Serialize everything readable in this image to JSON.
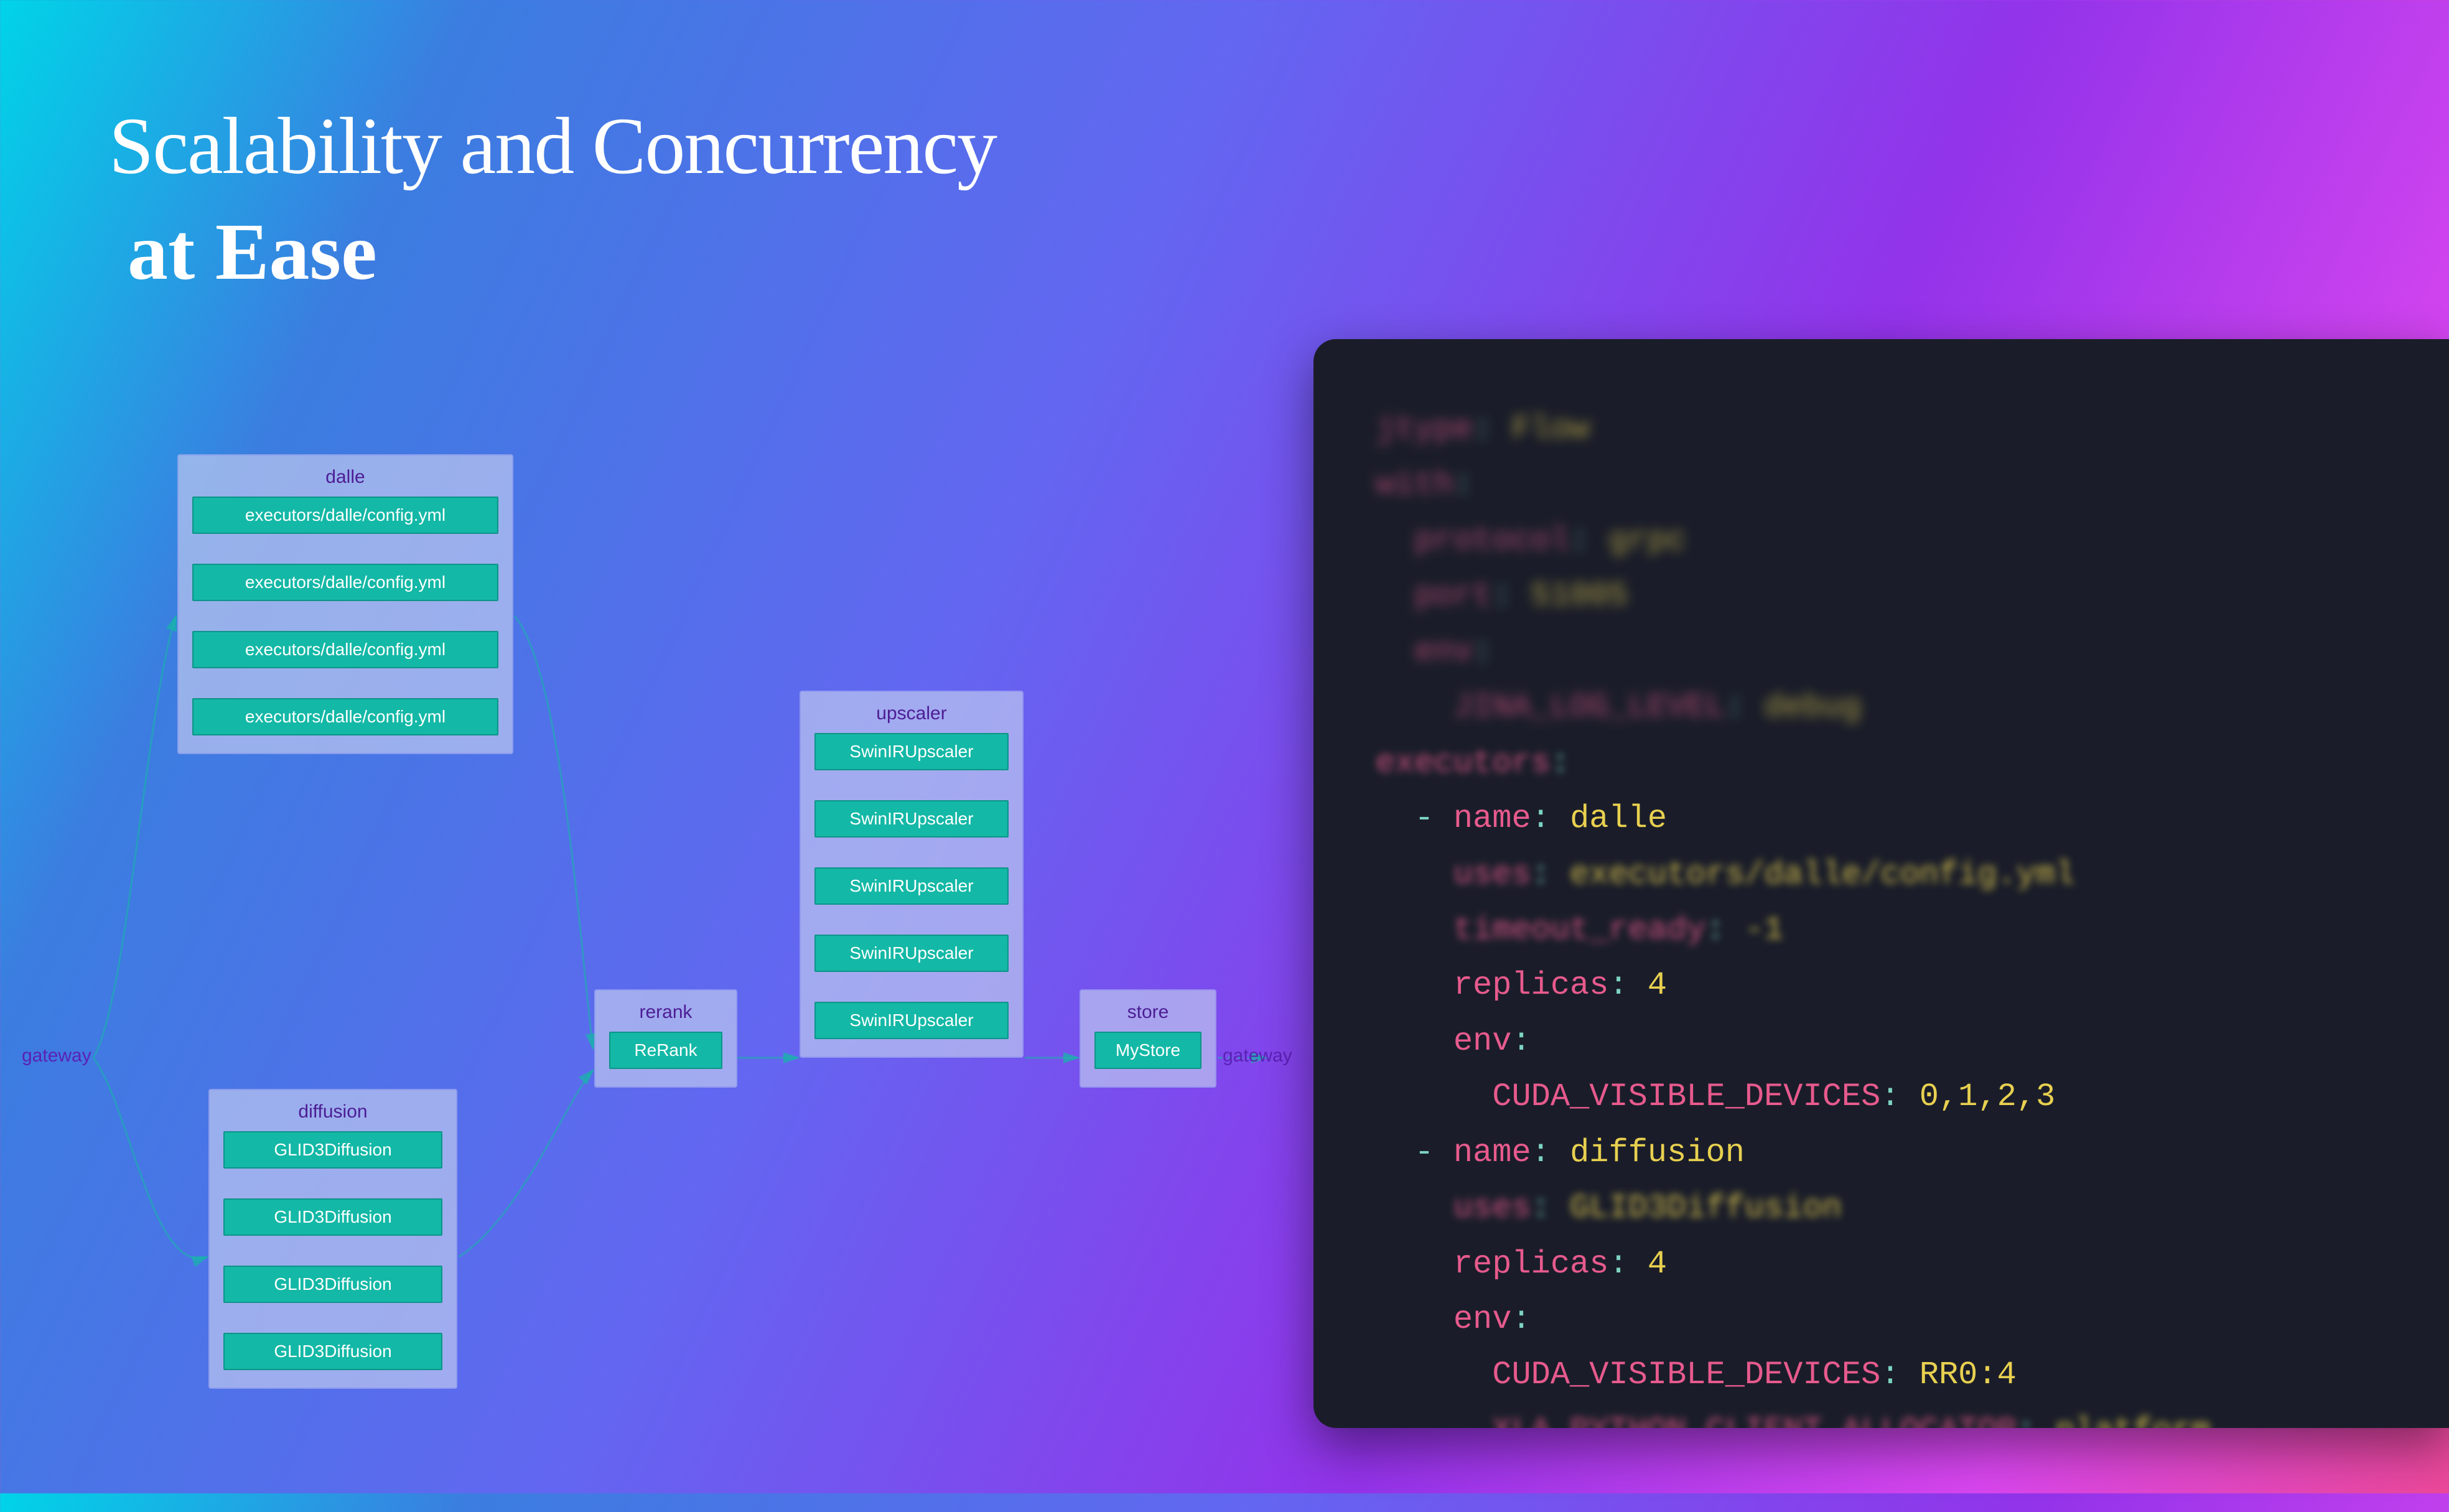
{
  "heading": {
    "line1": "Scalability and Concurrency",
    "line2": "at Ease"
  },
  "diagram": {
    "gateway_left": "gateway",
    "gateway_right": "gateway",
    "groups": {
      "dalle": {
        "title": "dalle",
        "items": [
          "executors/dalle/config.yml",
          "executors/dalle/config.yml",
          "executors/dalle/config.yml",
          "executors/dalle/config.yml"
        ]
      },
      "diffusion": {
        "title": "diffusion",
        "items": [
          "GLID3Diffusion",
          "GLID3Diffusion",
          "GLID3Diffusion",
          "GLID3Diffusion"
        ]
      },
      "rerank": {
        "title": "rerank",
        "items": [
          "ReRank"
        ]
      },
      "upscaler": {
        "title": "upscaler",
        "items": [
          "SwinIRUpscaler",
          "SwinIRUpscaler",
          "SwinIRUpscaler",
          "SwinIRUpscaler",
          "SwinIRUpscaler"
        ]
      },
      "store": {
        "title": "store",
        "items": [
          "MyStore"
        ]
      }
    }
  },
  "code": {
    "lines": [
      {
        "blur": "more",
        "tokens": [
          [
            "key",
            "jtype"
          ],
          [
            "punct",
            ": "
          ],
          [
            "val",
            "Flow"
          ]
        ]
      },
      {
        "blur": "more",
        "tokens": [
          [
            "key",
            "with"
          ],
          [
            "punct",
            ":"
          ]
        ]
      },
      {
        "blur": "more",
        "tokens": [
          [
            "plain",
            "  "
          ],
          [
            "key",
            "protocol"
          ],
          [
            "punct",
            ": "
          ],
          [
            "val",
            "grpc"
          ]
        ]
      },
      {
        "blur": "more",
        "tokens": [
          [
            "plain",
            "  "
          ],
          [
            "key",
            "port"
          ],
          [
            "punct",
            ": "
          ],
          [
            "val",
            "51005"
          ]
        ]
      },
      {
        "blur": "more",
        "tokens": [
          [
            "plain",
            "  "
          ],
          [
            "key",
            "env"
          ],
          [
            "punct",
            ":"
          ]
        ]
      },
      {
        "blur": "more",
        "tokens": [
          [
            "plain",
            "    "
          ],
          [
            "key",
            "JINA_LOG_LEVEL"
          ],
          [
            "punct",
            ": "
          ],
          [
            "val",
            "debug"
          ]
        ]
      },
      {
        "blur": "on",
        "tokens": [
          [
            "key",
            "executors"
          ],
          [
            "punct",
            ":"
          ]
        ]
      },
      {
        "blur": "off",
        "tokens": [
          [
            "plain",
            "  "
          ],
          [
            "punct",
            "- "
          ],
          [
            "key",
            "name"
          ],
          [
            "punct",
            ": "
          ],
          [
            "val",
            "dalle"
          ]
        ]
      },
      {
        "blur": "on",
        "tokens": [
          [
            "plain",
            "    "
          ],
          [
            "key",
            "uses"
          ],
          [
            "punct",
            ": "
          ],
          [
            "val",
            "executors/dalle/config.yml"
          ]
        ]
      },
      {
        "blur": "on",
        "tokens": [
          [
            "plain",
            "    "
          ],
          [
            "key",
            "timeout_ready"
          ],
          [
            "punct",
            ": "
          ],
          [
            "val",
            "-1"
          ]
        ]
      },
      {
        "blur": "off",
        "tokens": [
          [
            "plain",
            "    "
          ],
          [
            "key",
            "replicas"
          ],
          [
            "punct",
            ": "
          ],
          [
            "val",
            "4"
          ]
        ]
      },
      {
        "blur": "off",
        "tokens": [
          [
            "plain",
            "    "
          ],
          [
            "key",
            "env"
          ],
          [
            "punct",
            ":"
          ]
        ]
      },
      {
        "blur": "off",
        "tokens": [
          [
            "plain",
            "      "
          ],
          [
            "key",
            "CUDA_VISIBLE_DEVICES"
          ],
          [
            "punct",
            ": "
          ],
          [
            "val",
            "0,1,2,3"
          ]
        ]
      },
      {
        "blur": "off",
        "tokens": [
          [
            "plain",
            "  "
          ],
          [
            "punct",
            "- "
          ],
          [
            "key",
            "name"
          ],
          [
            "punct",
            ": "
          ],
          [
            "val",
            "diffusion"
          ]
        ]
      },
      {
        "blur": "on",
        "tokens": [
          [
            "plain",
            "    "
          ],
          [
            "key",
            "uses"
          ],
          [
            "punct",
            ": "
          ],
          [
            "val",
            "GLID3Diffusion"
          ]
        ]
      },
      {
        "blur": "off",
        "tokens": [
          [
            "plain",
            "    "
          ],
          [
            "key",
            "replicas"
          ],
          [
            "punct",
            ": "
          ],
          [
            "val",
            "4"
          ]
        ]
      },
      {
        "blur": "off",
        "tokens": [
          [
            "plain",
            "    "
          ],
          [
            "key",
            "env"
          ],
          [
            "punct",
            ":"
          ]
        ]
      },
      {
        "blur": "off",
        "tokens": [
          [
            "plain",
            "      "
          ],
          [
            "key",
            "CUDA_VISIBLE_DEVICES"
          ],
          [
            "punct",
            ": "
          ],
          [
            "val",
            "RR0:4"
          ]
        ]
      },
      {
        "blur": "on",
        "tokens": [
          [
            "plain",
            "      "
          ],
          [
            "key",
            "XLA_PYTHON_CLIENT_ALLOCATOR"
          ],
          [
            "punct",
            ": "
          ],
          [
            "val",
            "platform"
          ]
        ]
      }
    ]
  }
}
